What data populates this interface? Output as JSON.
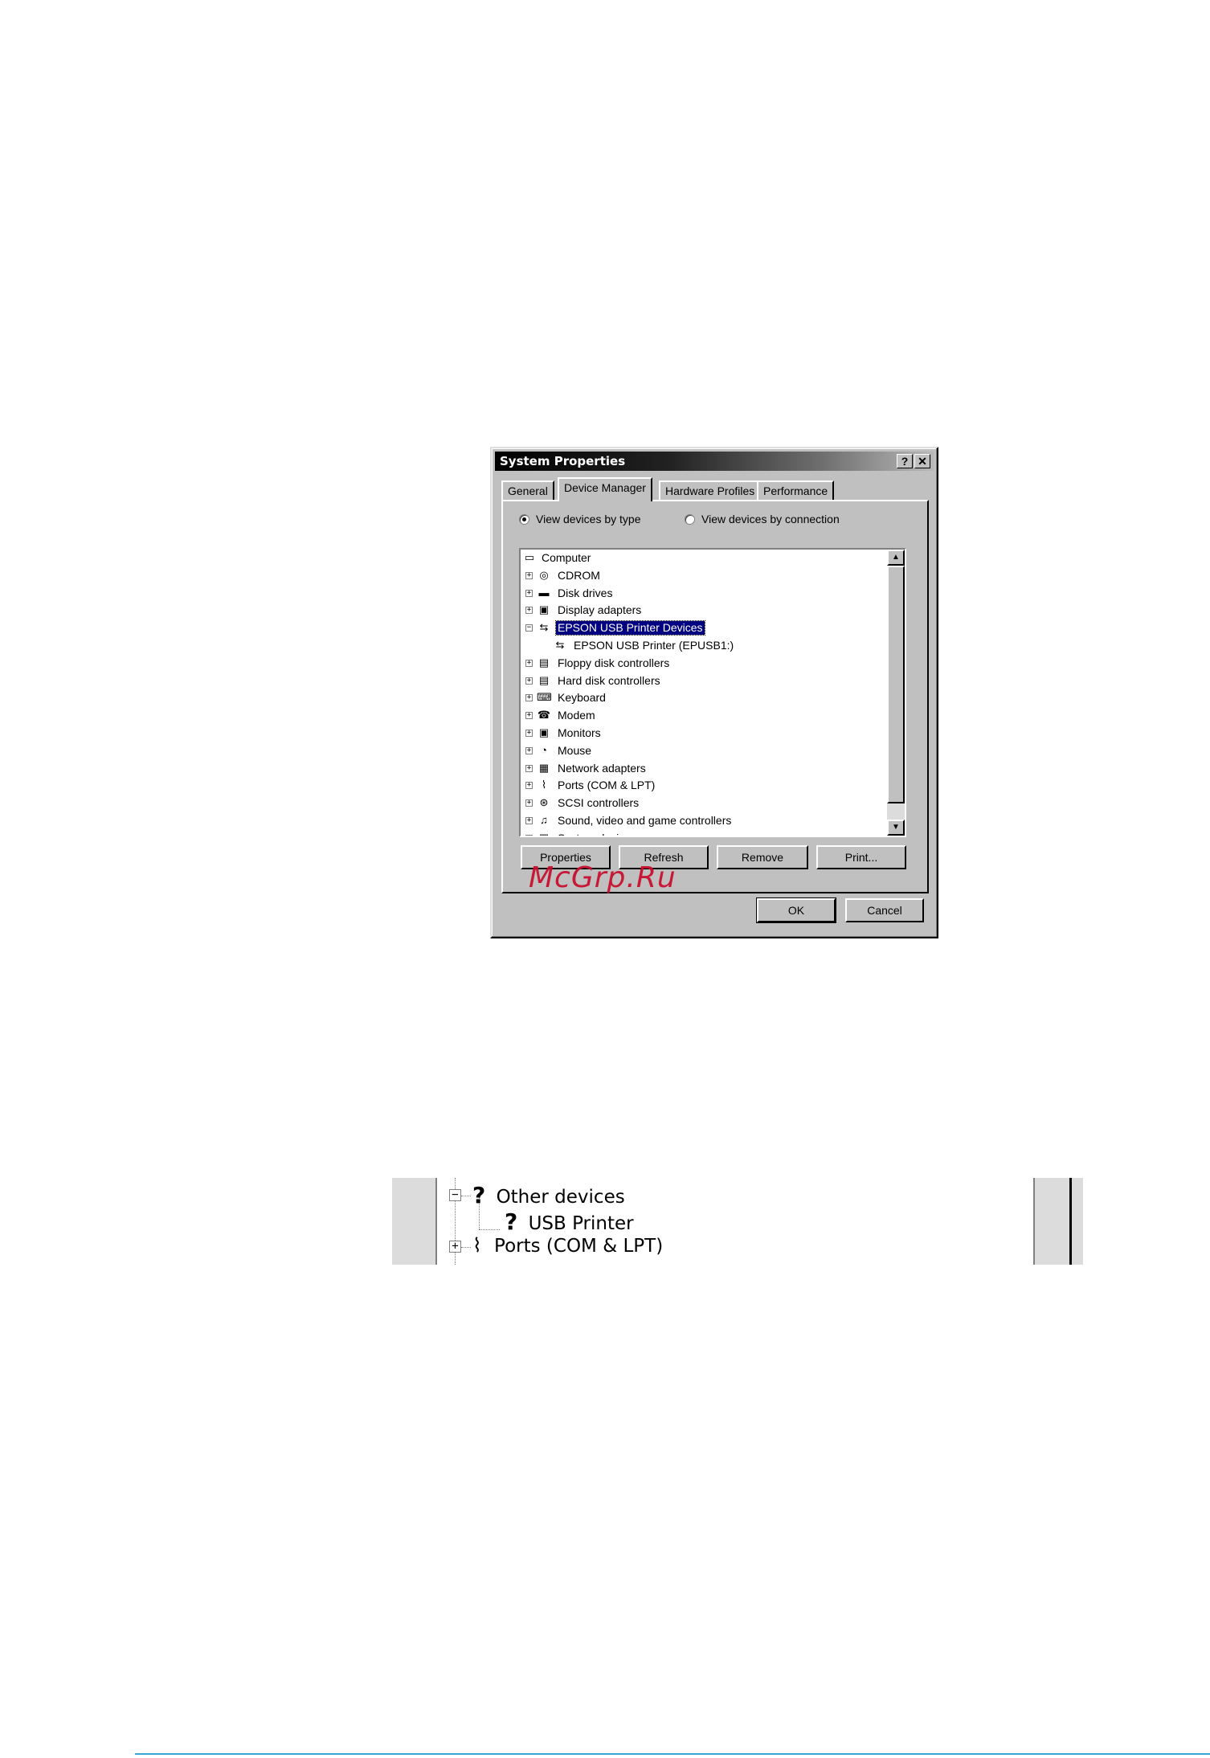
{
  "dialog": {
    "title": "System Properties",
    "help_glyph": "?",
    "close_glyph": "✕",
    "tabs": [
      {
        "label": "General",
        "active": false
      },
      {
        "label": "Device Manager",
        "active": true
      },
      {
        "label": "Hardware Profiles",
        "active": false
      },
      {
        "label": "Performance",
        "active": false
      }
    ],
    "view_options": [
      {
        "label": "View devices by type",
        "checked": true
      },
      {
        "label": "View devices by connection",
        "checked": false
      }
    ],
    "tree": [
      {
        "label": "Computer",
        "expander": "",
        "icon": "computer-icon",
        "level": 0
      },
      {
        "label": "CDROM",
        "expander": "+",
        "icon": "cdrom-icon",
        "level": 1
      },
      {
        "label": "Disk drives",
        "expander": "+",
        "icon": "disk-drive-icon",
        "level": 1
      },
      {
        "label": "Display adapters",
        "expander": "+",
        "icon": "display-adapter-icon",
        "level": 1
      },
      {
        "label": "EPSON USB Printer Devices",
        "expander": "−",
        "icon": "usb-icon",
        "level": 1,
        "selected": true
      },
      {
        "label": "EPSON USB Printer (EPUSB1:)",
        "expander": "",
        "icon": "usb-icon",
        "level": 2
      },
      {
        "label": "Floppy disk controllers",
        "expander": "+",
        "icon": "floppy-controller-icon",
        "level": 1
      },
      {
        "label": "Hard disk controllers",
        "expander": "+",
        "icon": "hard-disk-controller-icon",
        "level": 1
      },
      {
        "label": "Keyboard",
        "expander": "+",
        "icon": "keyboard-icon",
        "level": 1
      },
      {
        "label": "Modem",
        "expander": "+",
        "icon": "modem-icon",
        "level": 1
      },
      {
        "label": "Monitors",
        "expander": "+",
        "icon": "monitor-icon",
        "level": 1
      },
      {
        "label": "Mouse",
        "expander": "+",
        "icon": "mouse-icon",
        "level": 1
      },
      {
        "label": "Network adapters",
        "expander": "+",
        "icon": "network-adapter-icon",
        "level": 1
      },
      {
        "label": "Ports (COM & LPT)",
        "expander": "+",
        "icon": "port-icon",
        "level": 1
      },
      {
        "label": "SCSI controllers",
        "expander": "+",
        "icon": "scsi-icon",
        "level": 1
      },
      {
        "label": "Sound, video and game controllers",
        "expander": "+",
        "icon": "sound-icon",
        "level": 1
      },
      {
        "label": "System devices",
        "expander": "+",
        "icon": "system-devices-icon",
        "level": 1
      }
    ],
    "action_buttons": [
      "Properties",
      "Refresh",
      "Remove",
      "Print..."
    ],
    "ok_label": "OK",
    "cancel_label": "Cancel"
  },
  "watermark": "McGrp.Ru",
  "zoomed_tree": [
    {
      "label": "Other devices",
      "expander": "−",
      "icon": "unknown-device-icon"
    },
    {
      "label": "USB Printer",
      "expander": "",
      "icon": "unknown-device-icon"
    },
    {
      "label": "Ports (COM & LPT)",
      "expander": "+",
      "icon": "port-icon"
    }
  ],
  "colors": {
    "selection": "#000080",
    "watermark": "#c8102e",
    "rule": "#3aa6d6"
  }
}
